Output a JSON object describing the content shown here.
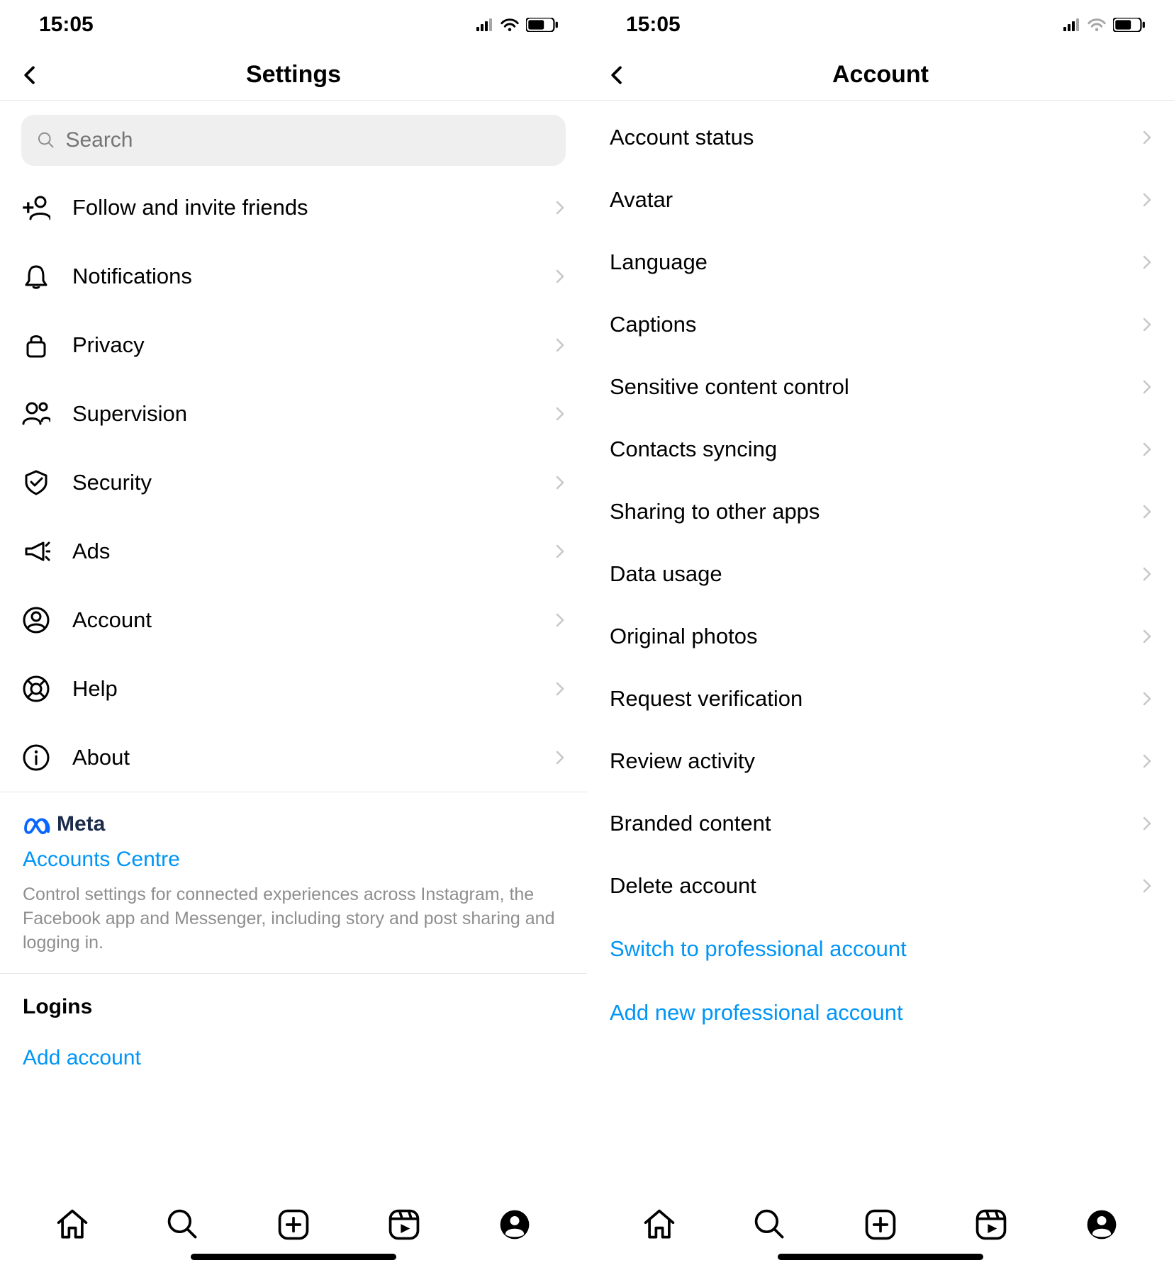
{
  "status": {
    "time": "15:05"
  },
  "left": {
    "title": "Settings",
    "search_placeholder": "Search",
    "items": [
      {
        "icon": "person-add-icon",
        "label": "Follow and invite friends"
      },
      {
        "icon": "bell-icon",
        "label": "Notifications"
      },
      {
        "icon": "lock-icon",
        "label": "Privacy"
      },
      {
        "icon": "people-icon",
        "label": "Supervision"
      },
      {
        "icon": "shield-icon",
        "label": "Security"
      },
      {
        "icon": "megaphone-icon",
        "label": "Ads"
      },
      {
        "icon": "account-icon",
        "label": "Account"
      },
      {
        "icon": "lifebuoy-icon",
        "label": "Help"
      },
      {
        "icon": "info-icon",
        "label": "About"
      }
    ],
    "meta": {
      "brand": "Meta",
      "accounts_centre": "Accounts Centre",
      "desc": "Control settings for connected experiences across Instagram, the Facebook app and Messenger, including story and post sharing and logging in."
    },
    "logins_title": "Logins",
    "add_account": "Add account"
  },
  "right": {
    "title": "Account",
    "items": [
      "Account status",
      "Avatar",
      "Language",
      "Captions",
      "Sensitive content control",
      "Contacts syncing",
      "Sharing to other apps",
      "Data usage",
      "Original photos",
      "Request verification",
      "Review activity",
      "Branded content",
      "Delete account"
    ],
    "links": [
      "Switch to professional account",
      "Add new professional account"
    ]
  }
}
